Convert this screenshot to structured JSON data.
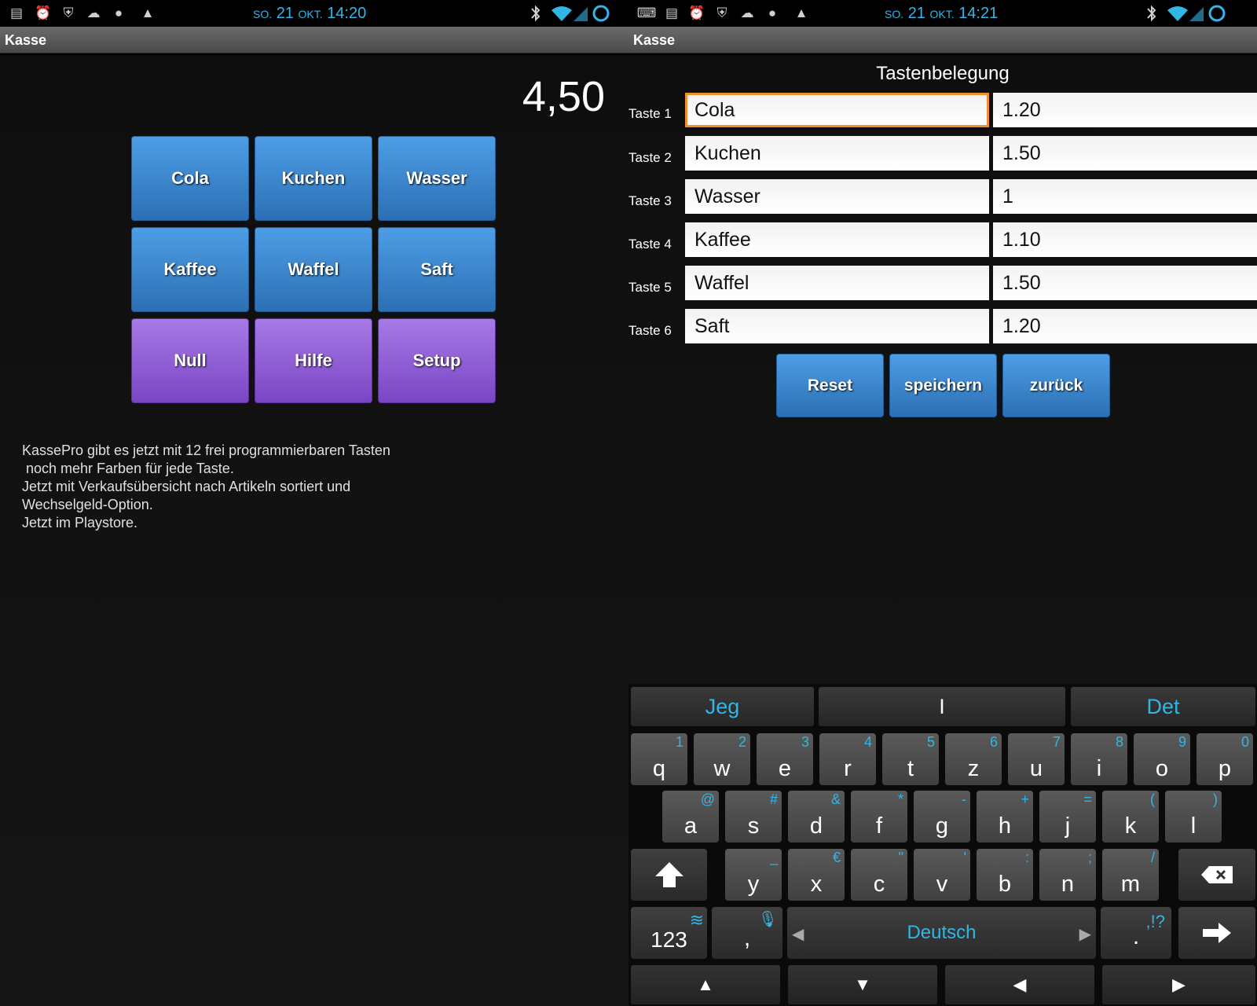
{
  "colors": {
    "accent": "#33b5e5",
    "key_blue": "#3a86d0",
    "key_purple": "#8f5fd8",
    "focus_orange": "#f0902b"
  },
  "left": {
    "status": {
      "day": "SO.",
      "date_num": "21",
      "month": "OKT.",
      "time": "14:20"
    },
    "title": "Kasse",
    "total": "4,50",
    "buttons": [
      "Cola",
      "Kuchen",
      "Wasser",
      "Kaffee",
      "Waffel",
      "Saft",
      "Null",
      "Hilfe",
      "Setup"
    ],
    "promo": "KassePro gibt es jetzt mit 12 frei programmierbaren Tasten\n noch mehr Farben für jede Taste.\nJetzt mit Verkaufsübersicht nach Artikeln sortiert und\nWechselgeld-Option.\nJetzt im Playstore."
  },
  "right": {
    "status": {
      "day": "SO.",
      "date_num": "21",
      "month": "OKT.",
      "time": "14:21"
    },
    "title": "Kasse",
    "heading": "Tastenbelegung",
    "rows": [
      {
        "label": "Taste 1",
        "name": "Cola",
        "price": "1.20"
      },
      {
        "label": "Taste 2",
        "name": "Kuchen",
        "price": "1.50"
      },
      {
        "label": "Taste 3",
        "name": "Wasser",
        "price": "1"
      },
      {
        "label": "Taste 4",
        "name": "Kaffee",
        "price": "1.10"
      },
      {
        "label": "Taste 5",
        "name": "Waffel",
        "price": "1.50"
      },
      {
        "label": "Taste 6",
        "name": "Saft",
        "price": "1.20"
      }
    ],
    "actions": [
      "Reset",
      "speichern",
      "zurück"
    ],
    "keyboard": {
      "suggestions": [
        "Jeg",
        "I",
        "Det"
      ],
      "row1": [
        [
          "q",
          "1"
        ],
        [
          "w",
          "2"
        ],
        [
          "e",
          "3"
        ],
        [
          "r",
          "4"
        ],
        [
          "t",
          "5"
        ],
        [
          "z",
          "6"
        ],
        [
          "u",
          "7"
        ],
        [
          "i",
          "8"
        ],
        [
          "o",
          "9"
        ],
        [
          "p",
          "0"
        ]
      ],
      "row2": [
        [
          "a",
          "@"
        ],
        [
          "s",
          "#"
        ],
        [
          "d",
          "&"
        ],
        [
          "f",
          "*"
        ],
        [
          "g",
          "-"
        ],
        [
          "h",
          "+"
        ],
        [
          "j",
          "="
        ],
        [
          "k",
          "("
        ],
        [
          "l",
          ")"
        ]
      ],
      "row3": [
        [
          "y",
          "_"
        ],
        [
          "x",
          "€"
        ],
        [
          "c",
          "\""
        ],
        [
          "v",
          "'"
        ],
        [
          "b",
          ":"
        ],
        [
          "n",
          ";"
        ],
        [
          "m",
          "/"
        ]
      ],
      "numbers_label": "123",
      "comma_label": ",",
      "language": "Deutsch",
      "period_label": ".",
      "punct_label": ",!?"
    }
  }
}
